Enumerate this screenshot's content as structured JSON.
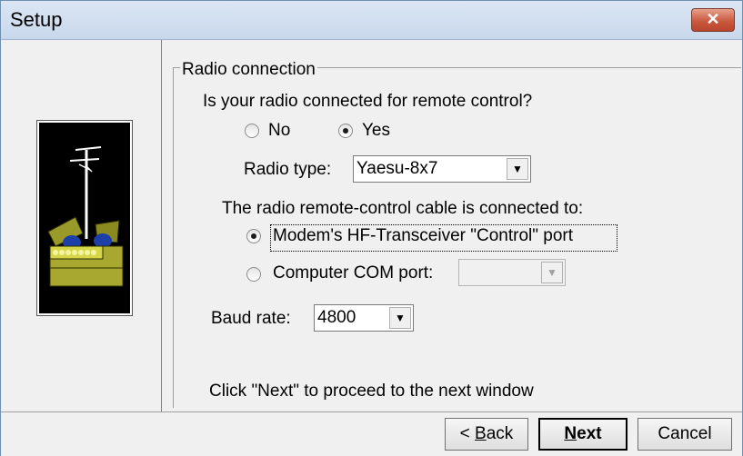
{
  "window": {
    "title": "Setup",
    "close_label": "✕"
  },
  "group": {
    "legend": "Radio connection",
    "question": "Is your radio connected for remote control?",
    "option_no": "No",
    "option_yes": "Yes",
    "selected_connected": "Yes",
    "radio_type_label": "Radio type:",
    "radio_type_value": "Yaesu-8x7",
    "cable_label": "The radio remote-control cable is connected to:",
    "cable_option_modem": "Modem's HF-Transceiver \"Control\" port",
    "cable_option_com": "Computer COM port:",
    "selected_cable": "Modem's HF-Transceiver \"Control\" port",
    "com_port_value": "",
    "baud_label": "Baud rate:",
    "baud_value": "4800",
    "hint": "Click \"Next\" to proceed to the next window"
  },
  "footer": {
    "back_prefix": "< ",
    "back_hotkey": "B",
    "back_rest": "ack",
    "next_hotkey": "N",
    "next_rest": "ext",
    "cancel_label": "Cancel"
  },
  "colors": {
    "window_bg": "#f0f0f0",
    "close_button": "#c95a40",
    "icon_bg": "#000000",
    "box_olive": "#9a9a2a"
  },
  "icons": [
    "close-icon",
    "antenna-box-illustration",
    "dropdown-arrow-icon"
  ]
}
